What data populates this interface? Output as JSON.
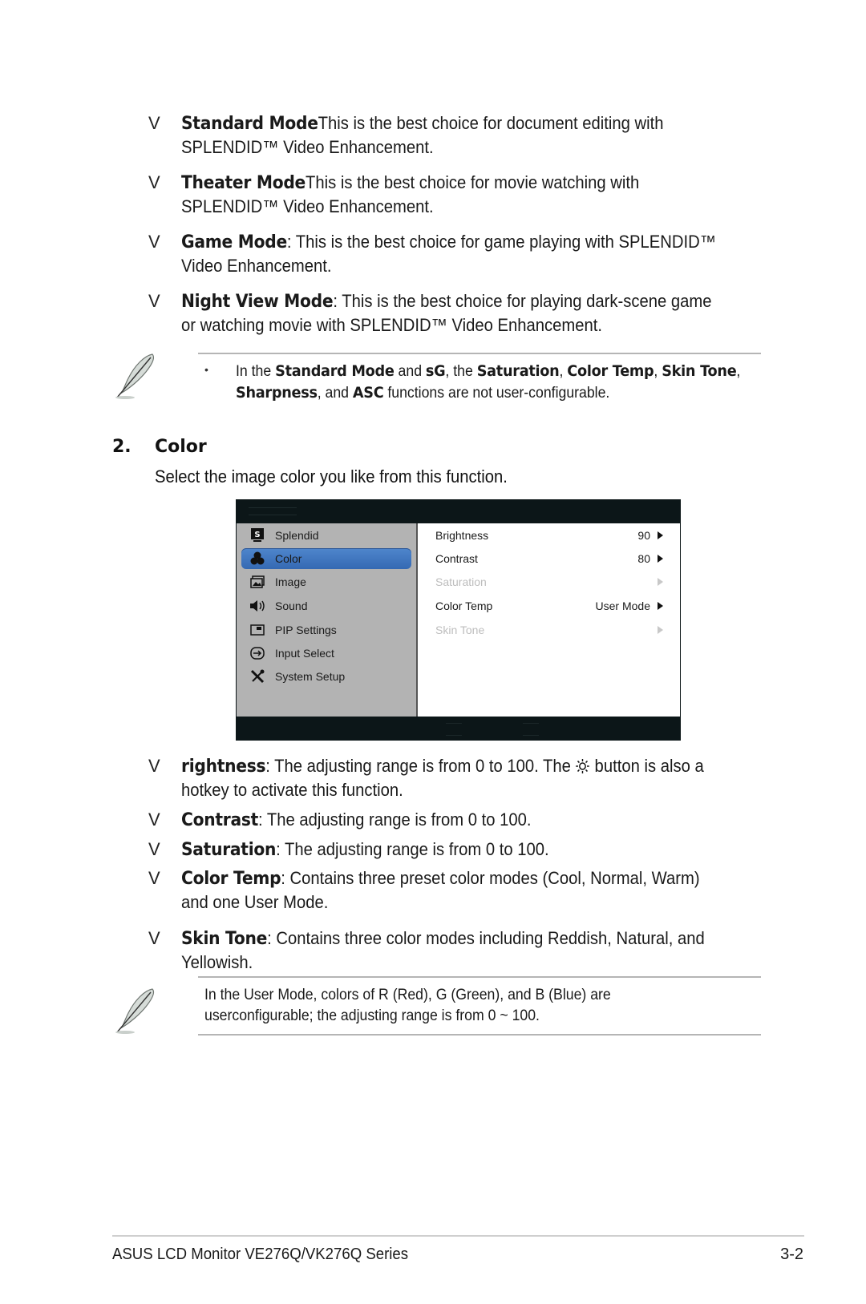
{
  "modes": [
    {
      "bullet": "V",
      "term": "Standard Mode",
      "text": "This is the best choice for document editing with SPLENDID™ Video Enhancement."
    },
    {
      "bullet": "V",
      "term": "Theater Mode",
      "text": "This is the best choice for movie watching with SPLENDID™ Video Enhancement."
    },
    {
      "bullet": "V",
      "term": "Game Mode",
      "text": ": This is the best choice for game playing with SPLENDID™ Video Enhancement."
    },
    {
      "bullet": "V",
      "term": "Night View Mode",
      "text": ": This is the best choice for playing dark-scene game or watching movie with SPLENDID™ Video Enhancement."
    }
  ],
  "note1": {
    "bullet": "•",
    "parts": [
      {
        "t": "In the ",
        "b": false
      },
      {
        "t": "Standard Mode",
        "b": true
      },
      {
        "t": " and ",
        "b": false
      },
      {
        "t": "sG",
        "b": true
      },
      {
        "t": ", the ",
        "b": false
      },
      {
        "t": "Saturation",
        "b": true
      },
      {
        "t": ", ",
        "b": false
      },
      {
        "t": "Color Temp",
        "b": true
      },
      {
        "t": ", ",
        "b": false
      },
      {
        "t": "Skin Tone",
        "b": true
      },
      {
        "t": ", ",
        "b": false
      },
      {
        "t": "Sharpness",
        "b": true
      },
      {
        "t": ", and ",
        "b": false
      },
      {
        "t": "ASC",
        "b": true
      },
      {
        "t": " functions are not user-configurable.",
        "b": false
      }
    ]
  },
  "section": {
    "number": "2.",
    "title": "Color",
    "description": "Select the image color you like from this function."
  },
  "osd": {
    "menu": [
      {
        "label": "Splendid",
        "icon": "splendid-icon",
        "selected": false
      },
      {
        "label": "Color",
        "icon": "color-icon",
        "selected": true
      },
      {
        "label": "Image",
        "icon": "image-icon",
        "selected": false
      },
      {
        "label": "Sound",
        "icon": "sound-icon",
        "selected": false
      },
      {
        "label": "PIP Settings",
        "icon": "pip-icon",
        "selected": false
      },
      {
        "label": "Input Select",
        "icon": "input-select-icon",
        "selected": false
      },
      {
        "label": "System Setup",
        "icon": "system-setup-icon",
        "selected": false
      }
    ],
    "options": [
      {
        "label": "Brightness",
        "value": "90",
        "enabled": true
      },
      {
        "label": "Contrast",
        "value": "80",
        "enabled": true
      },
      {
        "label": "Saturation",
        "value": "",
        "enabled": false
      },
      {
        "label": "Color Temp",
        "value": "User Mode",
        "enabled": true
      },
      {
        "label": "Skin Tone",
        "value": "",
        "enabled": false
      }
    ],
    "colors": {
      "selected_bg": "#3a6fb8",
      "left_bg": "#b3b3b3",
      "frame": "#0c1618"
    }
  },
  "functions": [
    {
      "bullet": "V",
      "term": "rightness",
      "text_before": ": The adjusting range is from 0 to 100. The ",
      "icon": "sun-icon",
      "text_after": " button is also a hotkey to activate this function."
    },
    {
      "bullet": "V",
      "term": "Contrast",
      "text_before": ": The adjusting range is from 0 to 100."
    },
    {
      "bullet": "V",
      "term": "Saturation",
      "text_before": ": The adjusting range is from 0 to 100."
    },
    {
      "bullet": "V",
      "term": "Color Temp",
      "text_before": ": Contains three preset color modes (Cool, Normal, Warm) and one User Mode."
    },
    {
      "bullet": "V",
      "term": "Skin Tone",
      "text_before": ": Contains three color modes including Reddish, Natural, and Yellowish."
    }
  ],
  "note2": {
    "text": "In the User Mode, colors of R (Red), G (Green), and B (Blue) are userconfigurable; the adjusting range is from 0 ~ 100."
  },
  "footer": {
    "title": "ASUS LCD Monitor VE276Q/VK276Q Series",
    "page": "3-2"
  }
}
